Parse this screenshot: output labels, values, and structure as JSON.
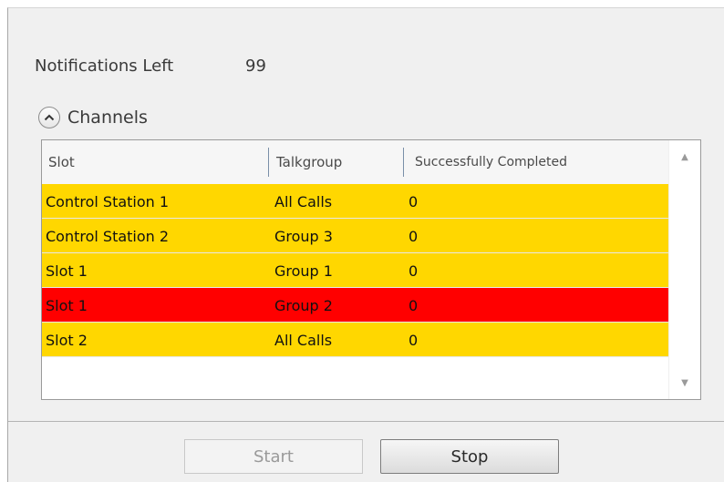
{
  "notifications": {
    "label": "Notifications Left",
    "value": "99"
  },
  "channels": {
    "label": "Channels",
    "collapse_icon": "chevron-up-icon"
  },
  "grid": {
    "columns": [
      "Slot",
      "Talkgroup",
      "Successfully Completed"
    ],
    "rows": [
      {
        "slot": "Control Station 1",
        "talkgroup": "All Calls",
        "completed": "0",
        "color": "#ffd700"
      },
      {
        "slot": "Control Station 2",
        "talkgroup": "Group 3",
        "completed": "0",
        "color": "#ffd700"
      },
      {
        "slot": "Slot 1",
        "talkgroup": "Group 1",
        "completed": "0",
        "color": "#ffd700"
      },
      {
        "slot": "Slot 1",
        "talkgroup": "Group 2",
        "completed": "0",
        "color": "#ff0000"
      },
      {
        "slot": "Slot 2",
        "talkgroup": "All Calls",
        "completed": "0",
        "color": "#ffd700"
      }
    ]
  },
  "buttons": {
    "start_label": "Start",
    "stop_label": "Stop"
  }
}
